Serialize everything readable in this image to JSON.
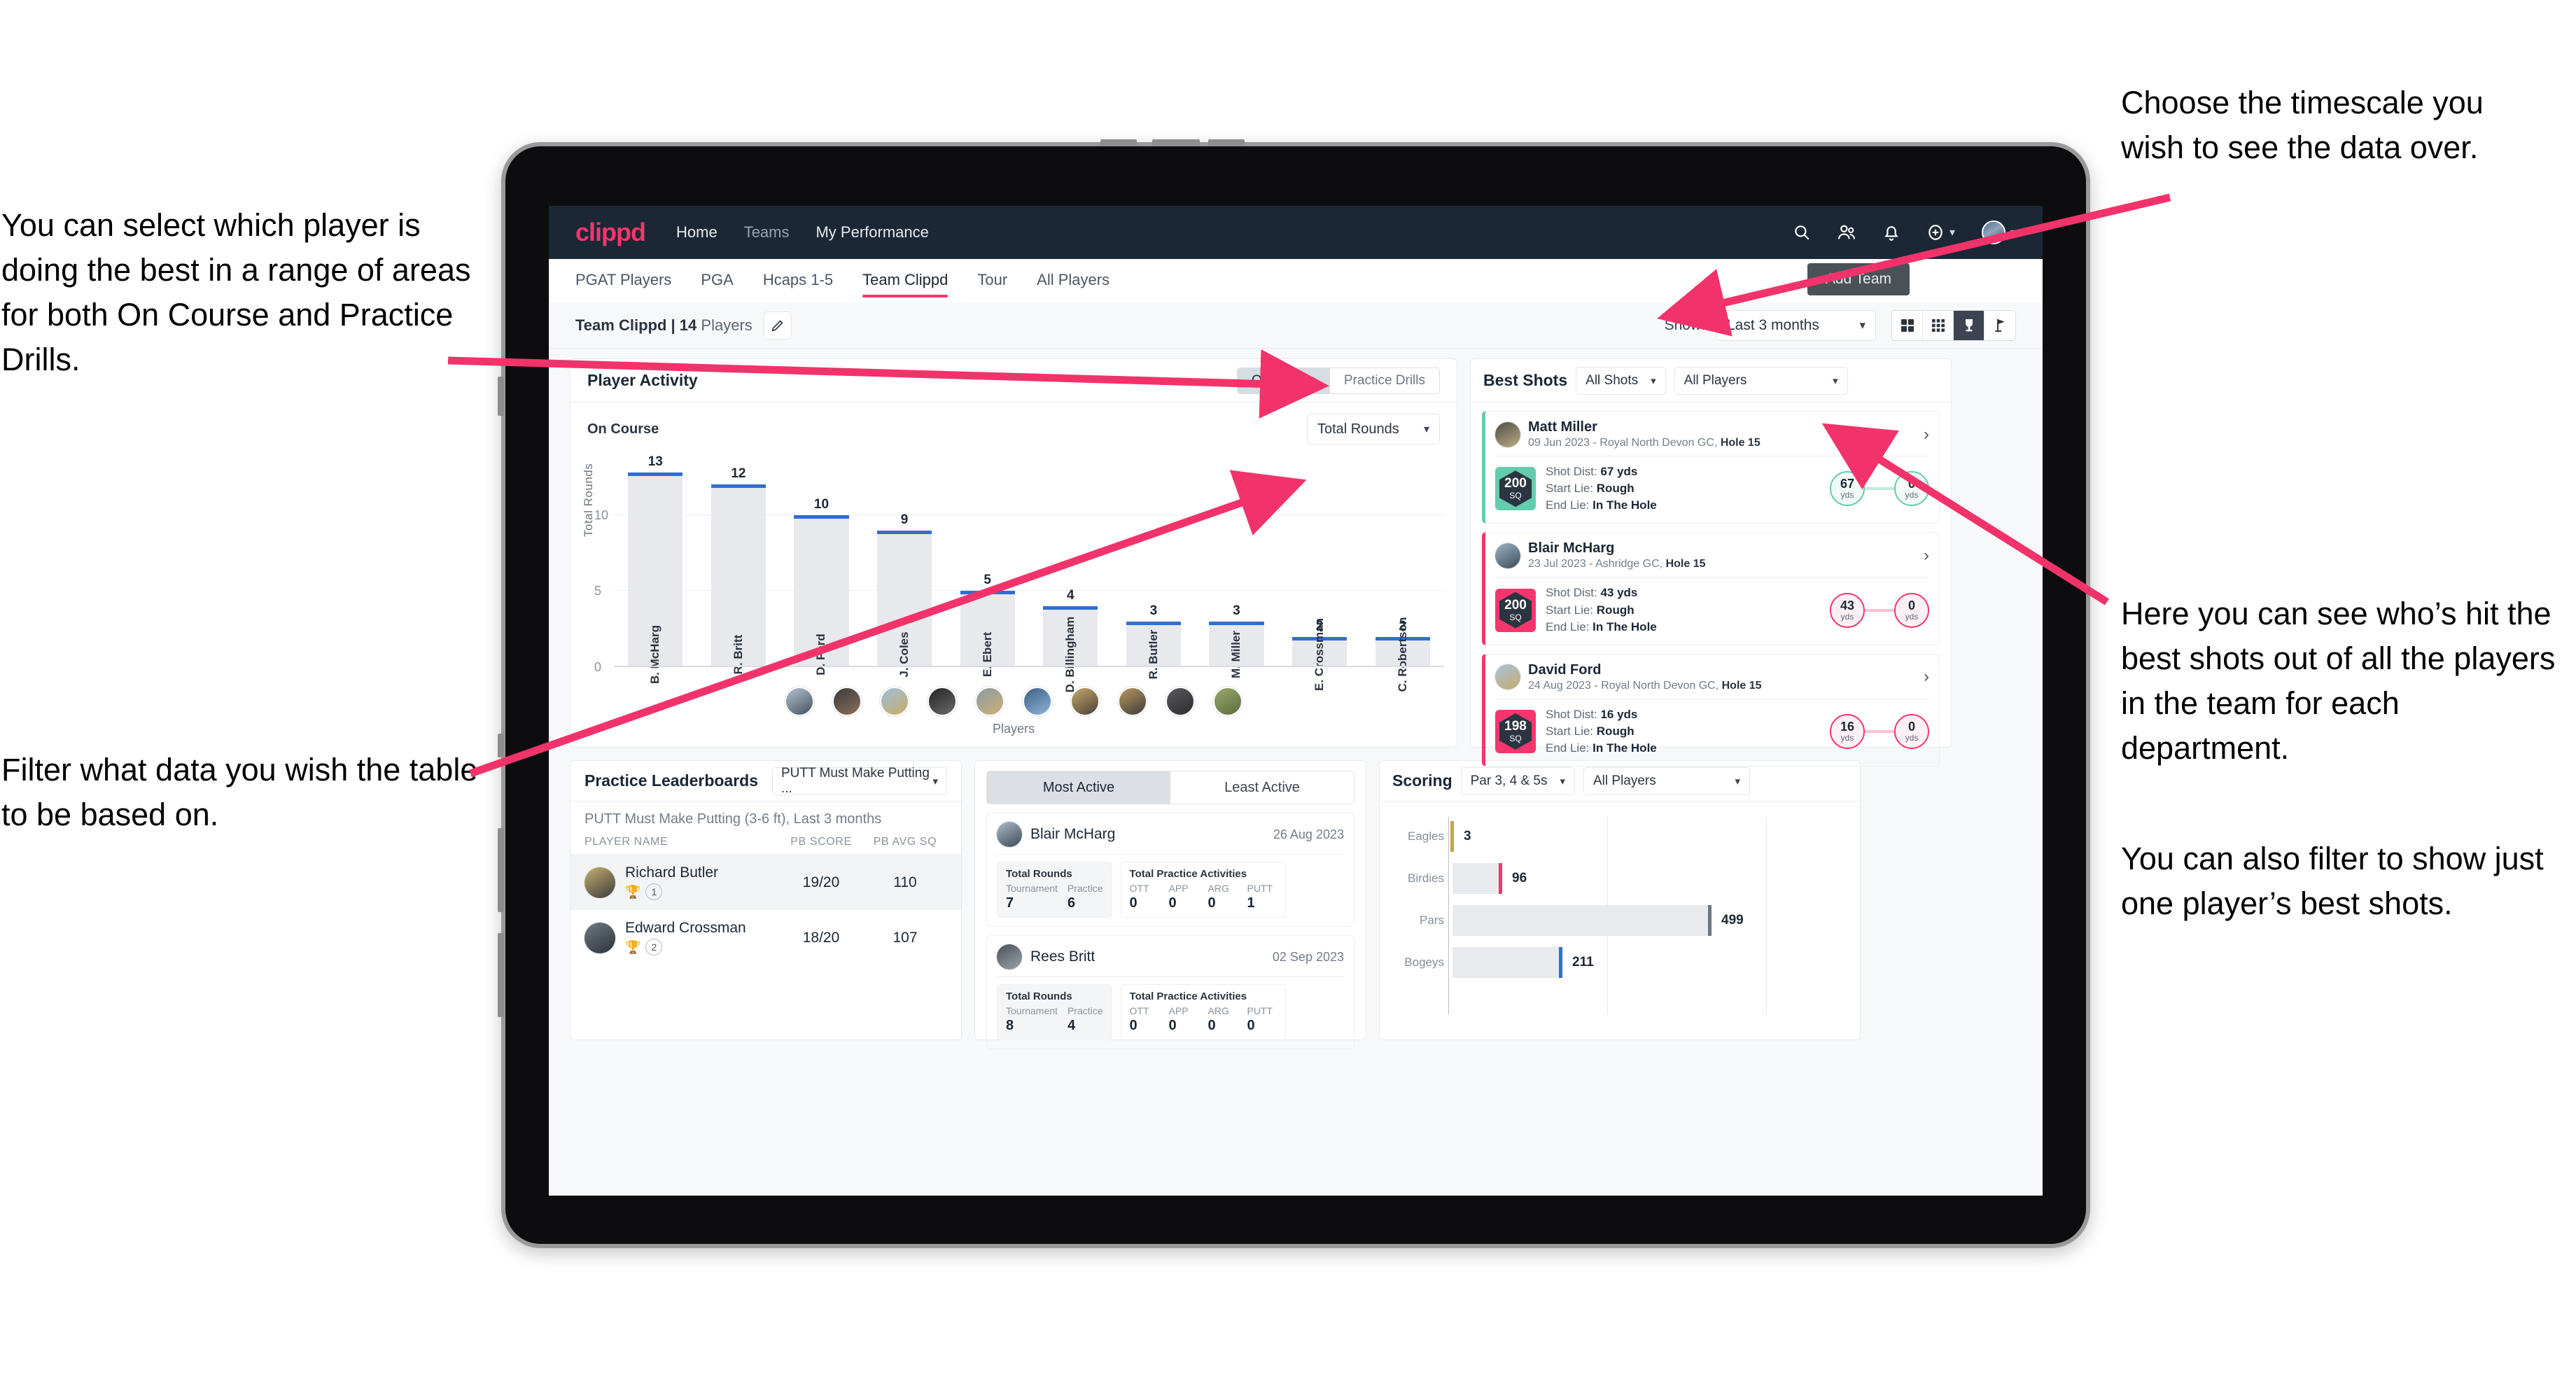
{
  "annotations": {
    "left_top": "You can select which player is doing the best in a range of areas for both On Course and Practice Drills.",
    "left_bottom": "Filter what data you wish the table to be based on.",
    "right_top": "Choose the timescale you wish to see the data over.",
    "right_middle": "Here you can see who’s hit the best shots out of all the players in the team for each department.",
    "right_bottom": "You can also filter to show just one player’s best shots."
  },
  "topnav": {
    "brand": "clippd",
    "links": [
      {
        "label": "Home",
        "active": true
      },
      {
        "label": "Teams",
        "active": false
      },
      {
        "label": "My Performance",
        "active": true
      }
    ],
    "icons": [
      "search-icon",
      "people-icon",
      "bell-icon",
      "plus-circle-icon",
      "avatar"
    ]
  },
  "tabs": {
    "items": [
      {
        "label": "PGAT Players",
        "active": false
      },
      {
        "label": "PGA",
        "active": false
      },
      {
        "label": "Hcaps 1-5",
        "active": false
      },
      {
        "label": "Team Clippd",
        "active": true
      },
      {
        "label": "Tour",
        "active": false
      },
      {
        "label": "All Players",
        "active": false
      }
    ],
    "add_team_label": "Add Team"
  },
  "toolbar": {
    "team_name": "Team Clippd",
    "separator": "|",
    "player_count": "14",
    "players_word": "Players",
    "edit_icon": "pencil-icon",
    "show_label": "Show:",
    "timescale_value": "Last 3 months",
    "view_buttons": [
      "grid-2x2-icon",
      "grid-3x3-icon",
      "trophy-icon",
      "flag-icon"
    ],
    "active_view": "trophy-icon"
  },
  "player_activity": {
    "title": "Player Activity",
    "segments": [
      {
        "label": "On Course",
        "active": true
      },
      {
        "label": "Practice Drills",
        "active": false
      }
    ],
    "sub_label": "On Course",
    "metric_select": "Total Rounds"
  },
  "chart_data": [
    {
      "type": "bar",
      "title": "Player Activity — On Course",
      "xlabel": "Players",
      "ylabel": "Total Rounds",
      "ylim": [
        0,
        14
      ],
      "yticks": [
        0,
        5,
        10
      ],
      "grid": true,
      "categories": [
        "B. McHarg",
        "R. Britt",
        "D. Ford",
        "J. Coles",
        "E. Ebert",
        "D. Billingham",
        "R. Butler",
        "M. Miller",
        "E. Crossman",
        "C. Robertson"
      ],
      "values": [
        13,
        12,
        10,
        9,
        5,
        4,
        3,
        3,
        2,
        2
      ],
      "bar_color": "#e7e9ed",
      "cap_color": "#2f6fd0"
    },
    {
      "type": "bar",
      "orientation": "horizontal",
      "title": "Scoring",
      "categories": [
        "Eagles",
        "Birdies",
        "Pars",
        "Bogeys"
      ],
      "values": [
        3,
        96,
        499,
        211
      ],
      "xlim": [
        0,
        620
      ],
      "grid": true,
      "cap_colors": [
        "#c7a44b",
        "#f5356e",
        "#6b7682",
        "#2f6fd0"
      ]
    }
  ],
  "best_shots": {
    "title": "Best Shots",
    "shot_filter": "All Shots",
    "player_filter": "All Players",
    "shots": [
      {
        "name": "Matt Miller",
        "date": "09 Jun 2023",
        "course": "Royal North Devon GC,",
        "hole": "Hole 15",
        "sq": "200",
        "sq_unit": "SQ",
        "shot_dist_label": "Shot Dist:",
        "shot_dist": "67 yds",
        "start_lie_label": "Start Lie:",
        "start_lie": "Rough",
        "end_lie_label": "End Lie:",
        "end_lie": "In The Hole",
        "from_val": "67",
        "from_unit": "yds",
        "to_val": "0",
        "to_unit": "yds",
        "accent": "teal"
      },
      {
        "name": "Blair McHarg",
        "date": "23 Jul 2023",
        "course": "Ashridge GC,",
        "hole": "Hole 15",
        "sq": "200",
        "sq_unit": "SQ",
        "shot_dist_label": "Shot Dist:",
        "shot_dist": "43 yds",
        "start_lie_label": "Start Lie:",
        "start_lie": "Rough",
        "end_lie_label": "End Lie:",
        "end_lie": "In The Hole",
        "from_val": "43",
        "from_unit": "yds",
        "to_val": "0",
        "to_unit": "yds",
        "accent": "pink"
      },
      {
        "name": "David Ford",
        "date": "24 Aug 2023",
        "course": "Royal North Devon GC,",
        "hole": "Hole 15",
        "sq": "198",
        "sq_unit": "SQ",
        "shot_dist_label": "Shot Dist:",
        "shot_dist": "16 yds",
        "start_lie_label": "Start Lie:",
        "start_lie": "Rough",
        "end_lie_label": "End Lie:",
        "end_lie": "In The Hole",
        "from_val": "16",
        "from_unit": "yds",
        "to_val": "0",
        "to_unit": "yds",
        "accent": "pink"
      }
    ]
  },
  "practice_leaderboards": {
    "title": "Practice Leaderboards",
    "drill_select": "PUTT Must Make Putting ...",
    "drill_title": "PUTT Must Make Putting (3-6 ft),",
    "drill_period": "Last 3 months",
    "columns": [
      "PLAYER NAME",
      "PB SCORE",
      "PB AVG SQ"
    ],
    "rows": [
      {
        "name": "Richard Butler",
        "rank": "1",
        "trophy": "gold",
        "pb_score": "19/20",
        "pb_avg_sq": "110"
      },
      {
        "name": "Edward Crossman",
        "rank": "2",
        "trophy": "silver",
        "pb_score": "18/20",
        "pb_avg_sq": "107"
      }
    ]
  },
  "activity": {
    "tabs": [
      {
        "label": "Most Active",
        "active": true
      },
      {
        "label": "Least Active",
        "active": false
      }
    ],
    "cards": [
      {
        "name": "Blair McHarg",
        "date": "26 Aug 2023",
        "rounds_title": "Total Rounds",
        "rounds_keys": [
          "Tournament",
          "Practice"
        ],
        "rounds_values": [
          "7",
          "6"
        ],
        "practice_title": "Total Practice Activities",
        "practice_keys": [
          "OTT",
          "APP",
          "ARG",
          "PUTT"
        ],
        "practice_values": [
          "0",
          "0",
          "0",
          "1"
        ]
      },
      {
        "name": "Rees Britt",
        "date": "02 Sep 2023",
        "rounds_title": "Total Rounds",
        "rounds_keys": [
          "Tournament",
          "Practice"
        ],
        "rounds_values": [
          "8",
          "4"
        ],
        "practice_title": "Total Practice Activities",
        "practice_keys": [
          "OTT",
          "APP",
          "ARG",
          "PUTT"
        ],
        "practice_values": [
          "0",
          "0",
          "0",
          "0"
        ]
      }
    ]
  },
  "scoring": {
    "title": "Scoring",
    "par_filter": "Par 3, 4 & 5s",
    "player_filter": "All Players",
    "rows": [
      {
        "label": "Eagles",
        "value": "3"
      },
      {
        "label": "Birdies",
        "value": "96"
      },
      {
        "label": "Pars",
        "value": "499"
      },
      {
        "label": "Bogeys",
        "value": "211"
      }
    ]
  },
  "colors": {
    "brand_pink": "#f5356e",
    "nav_dark": "#1b2735",
    "bar_blue": "#2f6fd0",
    "teal": "#63ccad"
  }
}
